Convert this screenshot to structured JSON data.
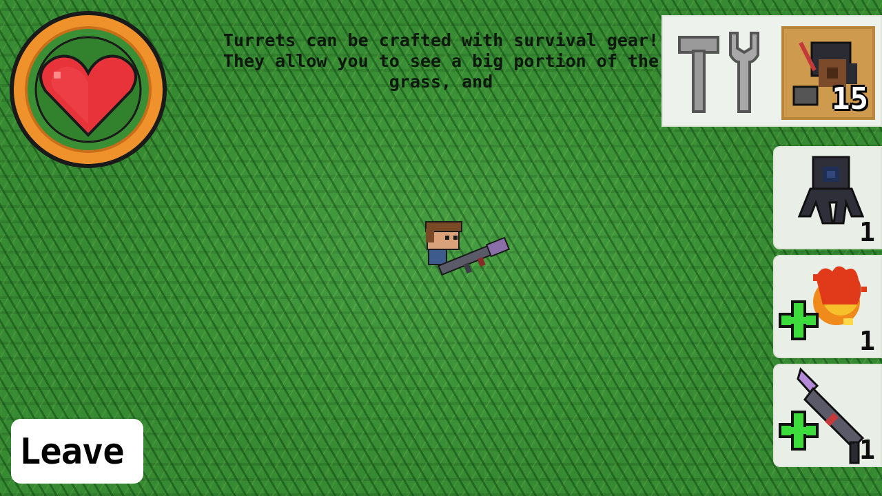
{
  "tutorial": {
    "line1": "Turrets can be crafted with survival gear!",
    "line2": "They allow you to see a big portion of the",
    "line3": "grass, and"
  },
  "hud": {
    "health_icon": "heart-icon",
    "craft_icon": "hammer-wrench-icon",
    "ammo": {
      "icon": "rocket-ammo-icon",
      "count": "15"
    }
  },
  "inventory": [
    {
      "icon": "turret-icon",
      "count": "1"
    },
    {
      "icon": "fire-plus-icon",
      "count": "1"
    },
    {
      "icon": "rocket-launcher-plus-icon",
      "count": "1"
    }
  ],
  "leave_label": "Leave",
  "colors": {
    "grass": "#3f9a3a",
    "health_ring": "#f0922b",
    "heart": "#e8333a",
    "panel": "#eef2ec",
    "ammo_tile": "#cd9a4e",
    "plus": "#3ddc3d"
  }
}
